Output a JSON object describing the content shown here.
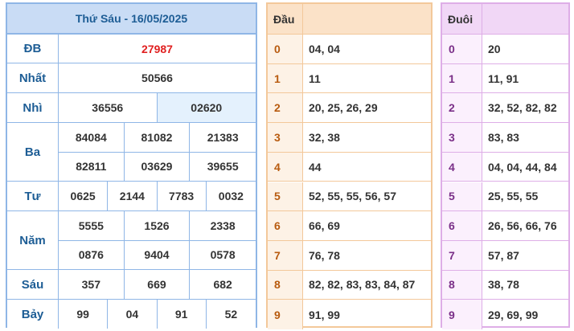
{
  "results": {
    "title": "Thứ Sáu - 16/05/2025",
    "prizes": [
      {
        "label": "ĐB",
        "rows": [
          [
            "27987"
          ]
        ],
        "special": true
      },
      {
        "label": "Nhất",
        "rows": [
          [
            "50566"
          ]
        ]
      },
      {
        "label": "Nhì",
        "rows": [
          [
            "36556",
            "02620"
          ]
        ]
      },
      {
        "label": "Ba",
        "rows": [
          [
            "84084",
            "81082",
            "21383"
          ],
          [
            "82811",
            "03629",
            "39655"
          ]
        ]
      },
      {
        "label": "Tư",
        "rows": [
          [
            "0625",
            "2144",
            "7783",
            "0032"
          ]
        ]
      },
      {
        "label": "Năm",
        "rows": [
          [
            "5555",
            "1526",
            "2338"
          ],
          [
            "0876",
            "9404",
            "0578"
          ]
        ]
      },
      {
        "label": "Sáu",
        "rows": [
          [
            "357",
            "669",
            "682"
          ]
        ]
      },
      {
        "label": "Bảy",
        "rows": [
          [
            "99",
            "04",
            "91",
            "52"
          ]
        ]
      }
    ]
  },
  "dau": {
    "header": "Đầu",
    "rows": [
      {
        "key": "0",
        "value": "04, 04"
      },
      {
        "key": "1",
        "value": "11"
      },
      {
        "key": "2",
        "value": "20, 25, 26, 29"
      },
      {
        "key": "3",
        "value": "32, 38"
      },
      {
        "key": "4",
        "value": "44"
      },
      {
        "key": "5",
        "value": "52, 55, 55, 56, 57"
      },
      {
        "key": "6",
        "value": "66, 69"
      },
      {
        "key": "7",
        "value": "76, 78"
      },
      {
        "key": "8",
        "value": "82, 82, 83, 83, 84, 87"
      },
      {
        "key": "9",
        "value": "91, 99"
      }
    ]
  },
  "duoi": {
    "header": "Đuôi",
    "rows": [
      {
        "key": "0",
        "value": "20"
      },
      {
        "key": "1",
        "value": "11, 91"
      },
      {
        "key": "2",
        "value": "32, 52, 82, 82"
      },
      {
        "key": "3",
        "value": "83, 83"
      },
      {
        "key": "4",
        "value": "04, 04, 44, 84"
      },
      {
        "key": "5",
        "value": "25, 55, 55"
      },
      {
        "key": "6",
        "value": "26, 56, 66, 76"
      },
      {
        "key": "7",
        "value": "57, 87"
      },
      {
        "key": "8",
        "value": "38, 78"
      },
      {
        "key": "9",
        "value": "29, 69, 99"
      }
    ]
  },
  "colors": {
    "results_border": "#8fb6e6",
    "results_header": "#c9dcf5",
    "special_prize": "#e02020",
    "dau_border": "#f3c89a",
    "duoi_border": "#deaee7"
  }
}
